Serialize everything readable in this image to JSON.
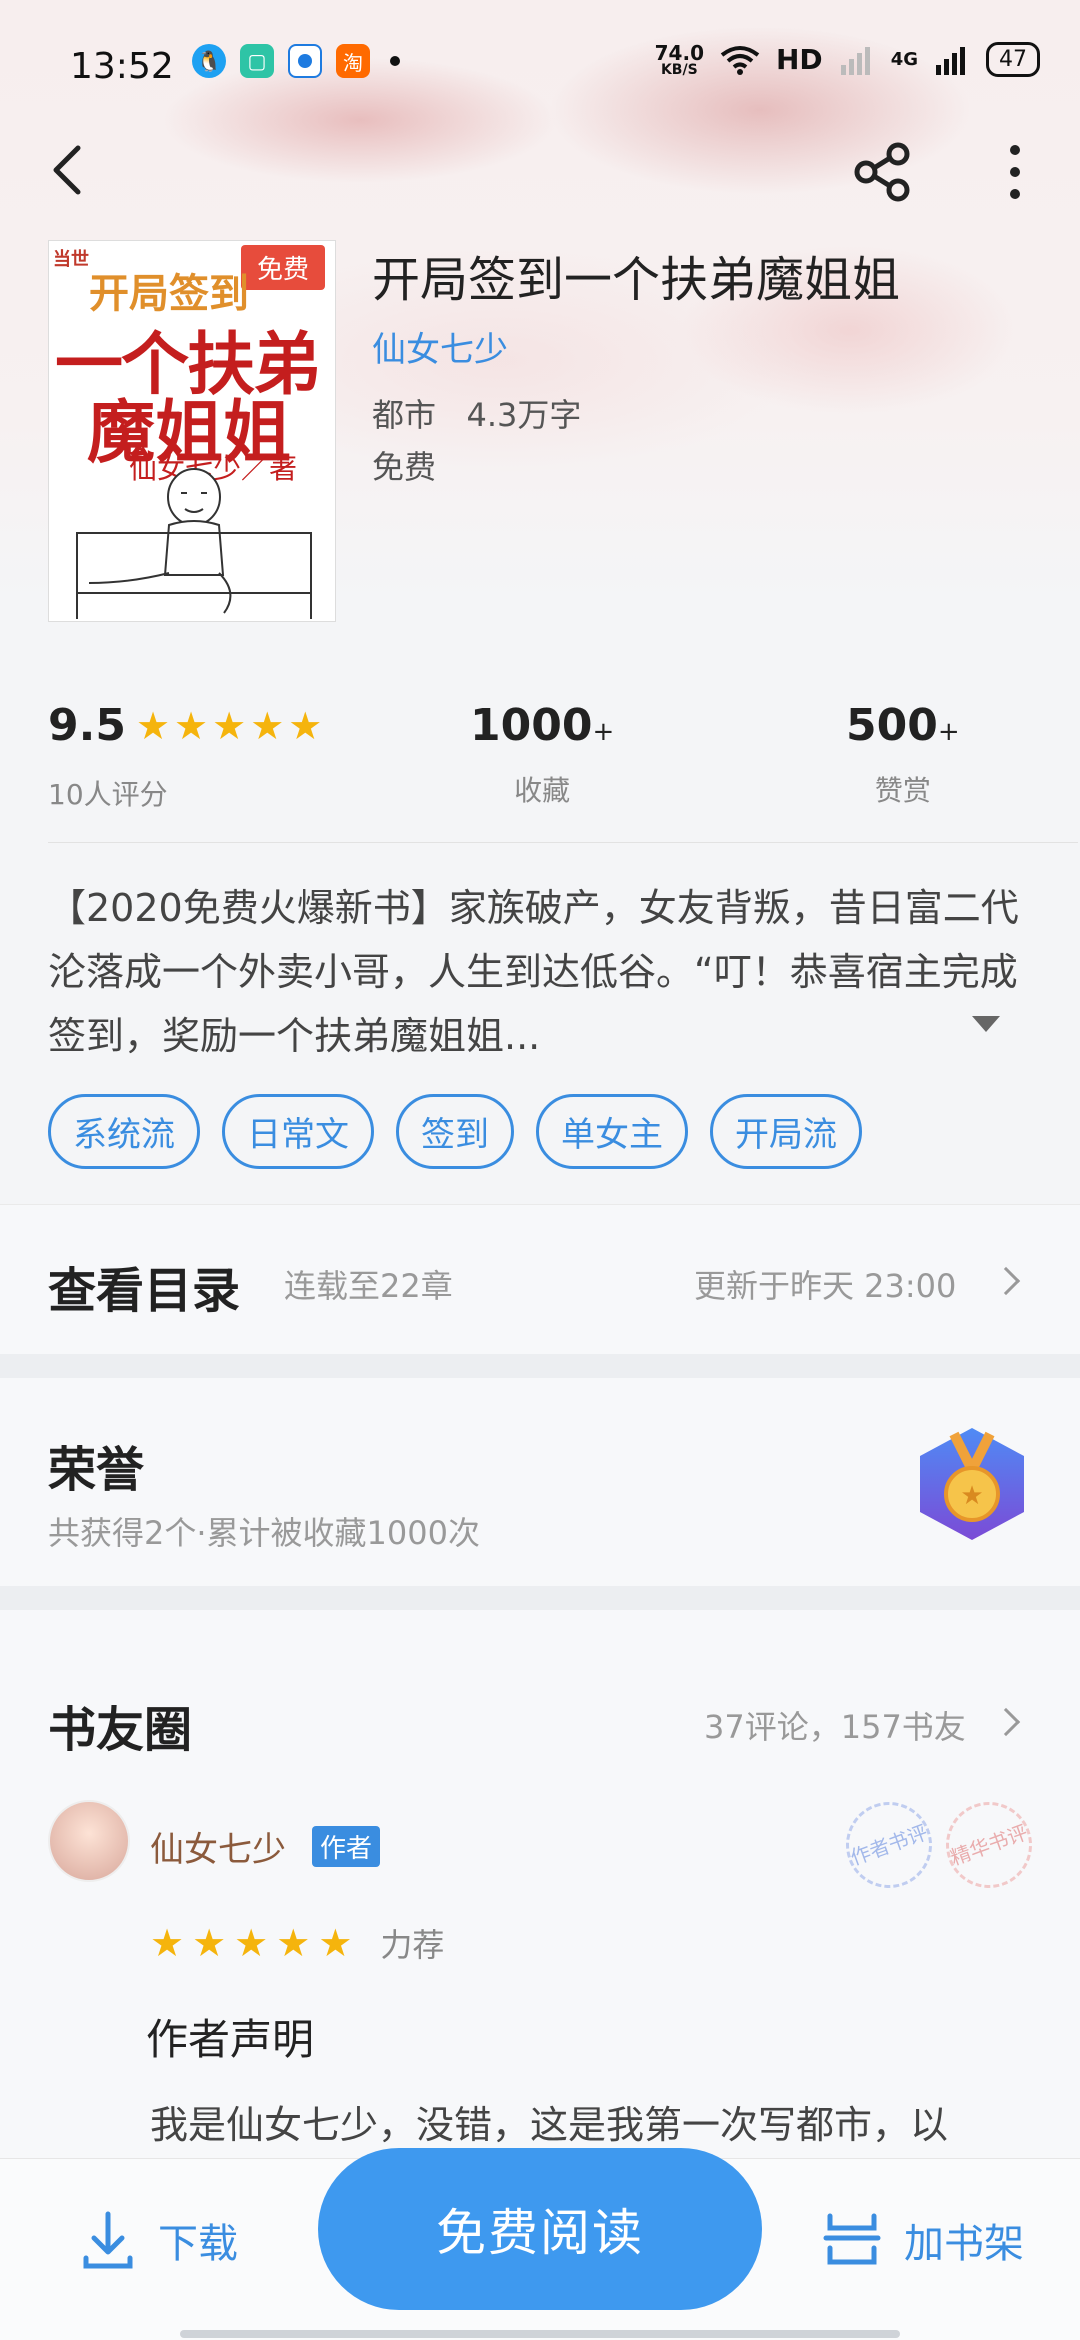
{
  "status_bar": {
    "time": "13:52",
    "net_speed_value": "74.0",
    "net_speed_unit": "KB/S",
    "hd_label": "HD",
    "network_label": "4G",
    "battery": "47"
  },
  "book": {
    "cover_free_tag": "免费",
    "cover_line1": "开局签到",
    "cover_line2": "一个扶弟",
    "cover_line3": "魔姐姐",
    "cover_author": "仙女七少／著",
    "title": "开局签到一个扶弟魔姐姐",
    "author": "仙女七少",
    "meta": "都市   4.3万字",
    "price": "免费"
  },
  "stats": {
    "rating_value": "9.5",
    "rating_label": "10人评分",
    "rating_stars": 5,
    "collect_value": "1000",
    "collect_suffix": "+",
    "collect_label": "收藏",
    "reward_value": "500",
    "reward_suffix": "+",
    "reward_label": "赞赏"
  },
  "description": "【2020免费火爆新书】家族破产，女友背叛，昔日富二代沦落成一个外卖小哥，人生到达低谷。“叮！恭喜宿主完成签到，奖励一个扶弟魔姐姐...",
  "tags": [
    "系统流",
    "日常文",
    "签到",
    "单女主",
    "开局流"
  ],
  "catalog": {
    "title": "查看目录",
    "progress": "连载至22章",
    "updated": "更新于昨天 23:00"
  },
  "honor": {
    "title": "荣誉",
    "subtitle": "共获得2个·累计被收藏1000次"
  },
  "circle": {
    "title": "书友圈",
    "stats": "37评论，157书友",
    "comment": {
      "user": "仙女七少",
      "badge": "作者",
      "stars": 5,
      "rating_text": "力荐",
      "stamp1": "作者书评",
      "stamp2": "精华书评",
      "title": "作者声明",
      "body": "我是仙女七少，没错，这是我第一次写都市，以"
    }
  },
  "bottom_bar": {
    "download": "下载",
    "read": "免费阅读",
    "add_shelf": "加书架"
  },
  "colors": {
    "accent": "#3a8de0",
    "button": "#3e99ef",
    "star": "#f5b40d",
    "free_tag": "#e74c3c"
  }
}
